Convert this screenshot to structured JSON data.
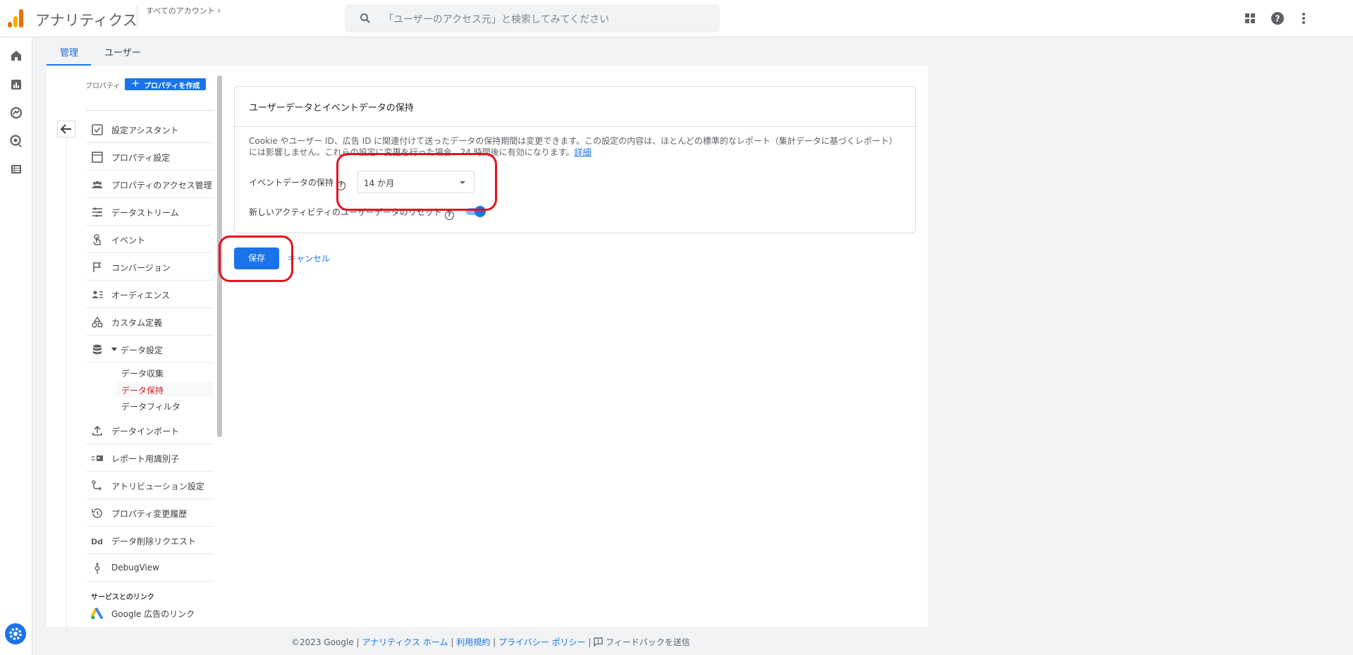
{
  "header": {
    "app_title": "アナリティクス",
    "account_link": "すべてのアカウント",
    "search_placeholder": "「ユーザーのアクセス元」と検索してみてください"
  },
  "tabs": {
    "admin": "管理",
    "user": "ユーザー"
  },
  "property": {
    "label": "プロパティ",
    "create_button": "プロパティを作成"
  },
  "nav": {
    "items": [
      {
        "label": "設定アシスタント",
        "icon": "checkbox-icon"
      },
      {
        "label": "プロパティ設定",
        "icon": "square-icon"
      },
      {
        "label": "プロパティのアクセス管理",
        "icon": "people-icon"
      },
      {
        "label": "データストリーム",
        "icon": "stream-icon"
      },
      {
        "label": "イベント",
        "icon": "touch-icon"
      },
      {
        "label": "コンバージョン",
        "icon": "flag-icon"
      },
      {
        "label": "オーディエンス",
        "icon": "audience-icon"
      },
      {
        "label": "カスタム定義",
        "icon": "shapes-icon"
      },
      {
        "label": "データ設定",
        "icon": "database-icon"
      },
      {
        "label": "データインポート",
        "icon": "upload-icon"
      },
      {
        "label": "レポート用識別子",
        "icon": "identifier-icon"
      },
      {
        "label": "アトリビューション設定",
        "icon": "attribution-icon"
      },
      {
        "label": "プロパティ変更履歴",
        "icon": "history-icon"
      },
      {
        "label": "データ削除リクエスト",
        "icon": "dd-icon"
      },
      {
        "label": "DebugView",
        "icon": "debug-icon"
      }
    ],
    "sub_items": [
      {
        "label": "データ収集",
        "active": false
      },
      {
        "label": "データ保持",
        "active": true
      },
      {
        "label": "データフィルタ",
        "active": false
      }
    ],
    "section_heading": "サービスとのリンク",
    "link_item": "Google 広告のリンク"
  },
  "card": {
    "title": "ユーザーデータとイベントデータの保持",
    "description": "Cookie やユーザー ID、広告 ID に関連付けて送ったデータの保持期間は変更できます。この設定の内容は、ほとんどの標準的なレポート（集計データに基づくレポート）には影響しません。これらの設定に変更を行った場合、24 時間後に有効になります。",
    "details_link": "詳細",
    "event_retention_label": "イベントデータの保持",
    "event_retention_value": "14 か月",
    "reset_label": "新しいアクティビティのユーザーデータのリセット"
  },
  "actions": {
    "save": "保存",
    "cancel": "キャンセル"
  },
  "footer": {
    "copyright": "©2023 Google",
    "sep": "|",
    "home": "アナリティクス ホーム",
    "terms": "利用規約",
    "privacy": "プライバシー ポリシー",
    "feedback": "フィードバックを送信"
  },
  "colors": {
    "accent": "#1a73e8",
    "highlight": "#e31221",
    "active_sub": "#c5221f"
  }
}
